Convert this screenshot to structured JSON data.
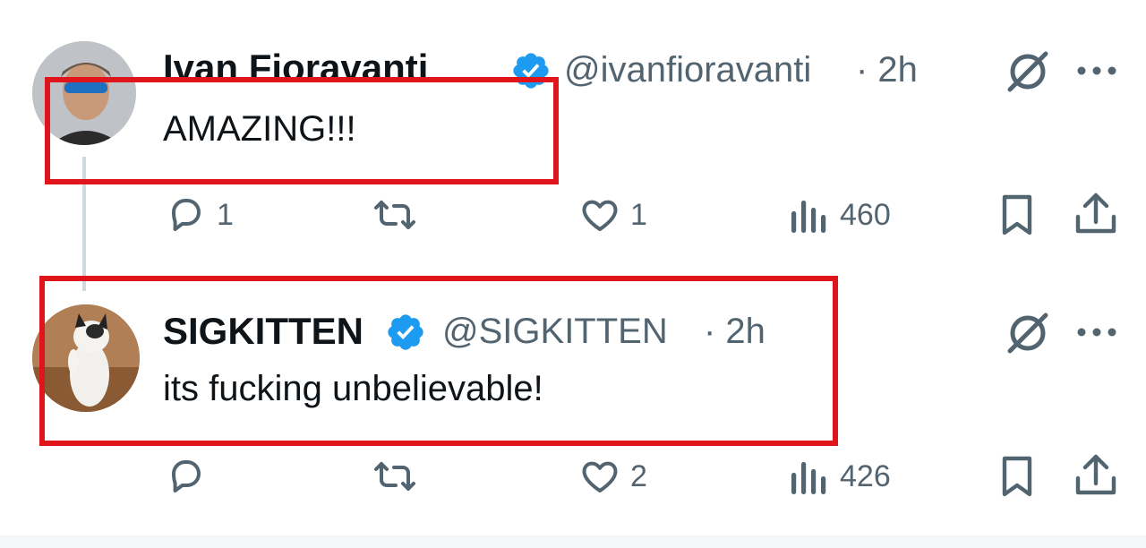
{
  "tweets": [
    {
      "author": "Ivan Fioravanti",
      "handle": "@ivanfioravanti",
      "time": "· 2h",
      "text": "AMAZING!!!",
      "replies": "1",
      "likes": "1",
      "views": "460",
      "verified": true
    },
    {
      "author": "SIGKITTEN",
      "handle": "@SIGKITTEN",
      "time": "· 2h",
      "text": "its fucking unbelievable!",
      "replies": "",
      "likes": "2",
      "views": "426",
      "verified": true
    }
  ],
  "colors": {
    "verified": "#1d9bf0",
    "highlight": "#e0141b",
    "icon": "#536471"
  },
  "icons": {
    "grok": "grok-icon",
    "more": "more-icon",
    "reply": "reply-icon",
    "retweet": "retweet-icon",
    "like": "like-icon",
    "views": "views-icon",
    "bookmark": "bookmark-icon",
    "share": "share-icon"
  }
}
